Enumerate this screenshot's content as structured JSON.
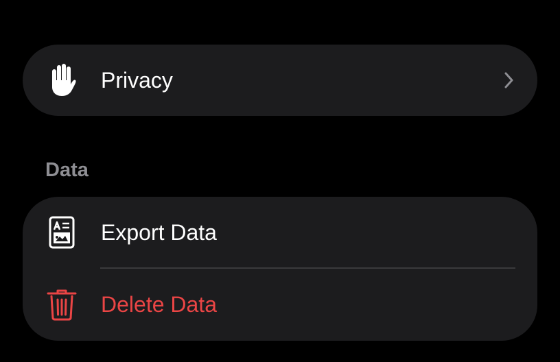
{
  "privacy_card": {
    "label": "Privacy",
    "icon": "hand-raised-icon"
  },
  "data_section": {
    "header": "Data",
    "items": [
      {
        "label": "Export Data",
        "icon": "document-export-icon"
      },
      {
        "label": "Delete Data",
        "icon": "trash-icon"
      }
    ]
  },
  "colors": {
    "background": "#000000",
    "card": "#1c1c1e",
    "text": "#ffffff",
    "secondary_text": "#8e8e93",
    "destructive": "#eb4545",
    "chevron": "#8e8e93",
    "separator": "#3a3a3c"
  }
}
